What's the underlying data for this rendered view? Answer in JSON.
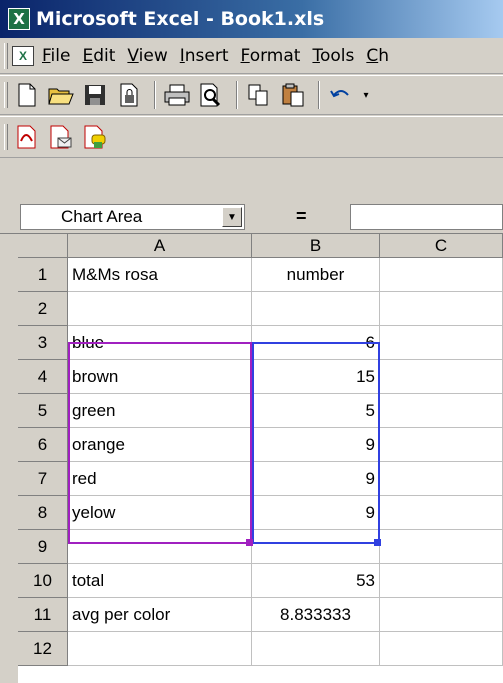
{
  "window": {
    "title": "Microsoft Excel - Book1.xls",
    "app_icon": "excel-icon"
  },
  "menubar": {
    "items": [
      "File",
      "Edit",
      "View",
      "Insert",
      "Format",
      "Tools",
      "Ch"
    ]
  },
  "toolbar_standard": {
    "icons": [
      "new-icon",
      "open-icon",
      "save-icon",
      "permission-icon",
      "print-icon",
      "print-preview-icon",
      "copy-icon",
      "paste-icon",
      "undo-icon",
      "undo-dropdown-icon"
    ]
  },
  "toolbar_pdf": {
    "icons": [
      "pdf-convert-icon",
      "pdf-email-icon",
      "pdf-review-icon"
    ]
  },
  "formula_bar": {
    "name_box": "Chart Area",
    "equals": "=",
    "value": ""
  },
  "grid": {
    "columns": [
      "A",
      "B",
      "C"
    ],
    "rows": [
      {
        "num": "1",
        "a": "M&Ms rosa",
        "b": "number",
        "b_align": "center"
      },
      {
        "num": "2",
        "a": "",
        "b": ""
      },
      {
        "num": "3",
        "a": "blue",
        "b": "6"
      },
      {
        "num": "4",
        "a": "brown",
        "b": "15"
      },
      {
        "num": "5",
        "a": "green",
        "b": "5"
      },
      {
        "num": "6",
        "a": "orange",
        "b": "9"
      },
      {
        "num": "7",
        "a": "red",
        "b": "9"
      },
      {
        "num": "8",
        "a": "yelow",
        "b": "9"
      },
      {
        "num": "9",
        "a": "",
        "b": ""
      },
      {
        "num": "10",
        "a": "total",
        "b": "53"
      },
      {
        "num": "11",
        "a": "avg per color",
        "b": "8.833333",
        "b_align": "center"
      },
      {
        "num": "12",
        "a": "",
        "b": ""
      }
    ]
  },
  "colors": {
    "range_a_border": "#a020c0",
    "range_b_border": "#3040e0"
  }
}
